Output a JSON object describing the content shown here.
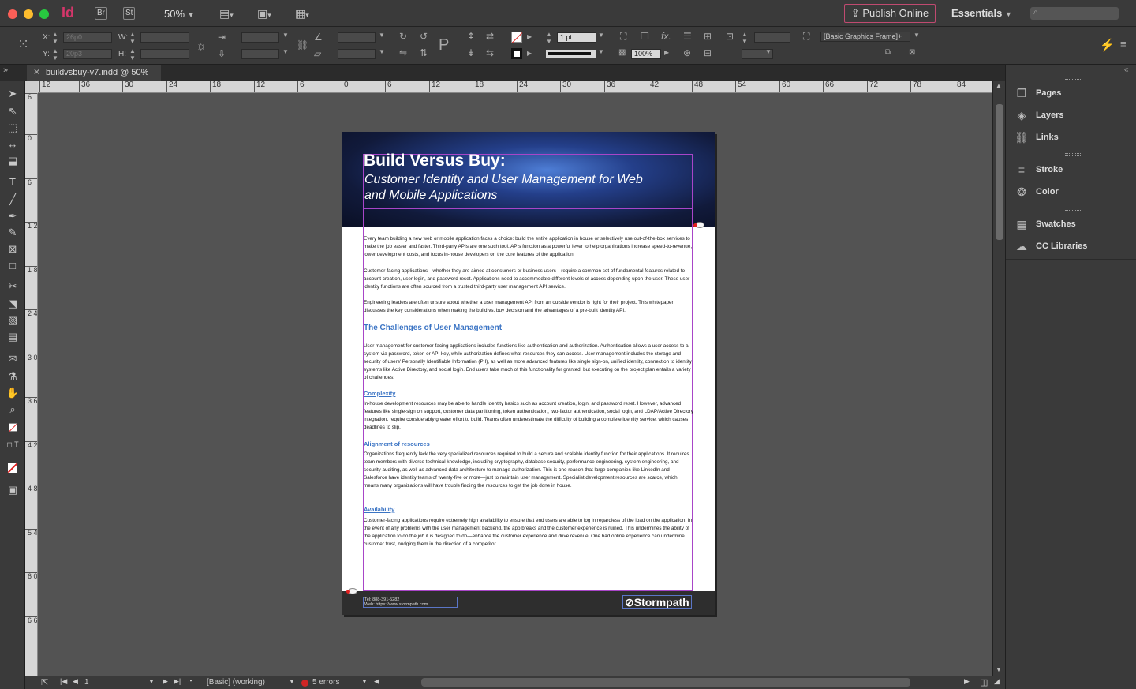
{
  "window": {
    "app_icon": "Id",
    "bridge_button": "Br",
    "stock_button": "St",
    "zoom": "50%",
    "publish_online": "Publish Online",
    "workspace": "Essentials"
  },
  "control": {
    "x_label": "X:",
    "x_value": "26p0",
    "y_label": "Y:",
    "y_value": "20p3",
    "w_label": "W:",
    "h_label": "H:",
    "stroke_weight": "1 pt",
    "opacity": "100%",
    "object_style": "[Basic Graphics Frame]+"
  },
  "tab": {
    "title": "buildvsbuy-v7.indd @ 50%"
  },
  "ruler": {
    "h_ticks": [
      "12",
      "36",
      "30",
      "24",
      "18",
      "12",
      "6",
      "0",
      "6",
      "12",
      "18",
      "24",
      "30",
      "36",
      "42",
      "48",
      "54",
      "60",
      "66",
      "72",
      "78",
      "84"
    ],
    "v_ticks": [
      "6",
      "0",
      "6",
      "1 2",
      "1 8",
      "2 4",
      "3 0",
      "3 6",
      "4 2",
      "4 8",
      "5 4",
      "6 0",
      "6 6"
    ]
  },
  "document": {
    "title": "Build Versus Buy:",
    "subtitle": "Customer Identity and User Management for Web and Mobile Applications",
    "intro_p1": "Every team building a new web or mobile application faces a choice: build the entire application in house or selectively use out-of-the-box services to make the job easier and faster. Third-party APIs are one such tool. APIs function as a powerful lever to help organizations increase speed-to-revenue, lower development costs, and focus in-house developers on the core features of the application.",
    "intro_p2": "Customer-facing applications—whether they are aimed at consumers or business users—require a common set of fundamental features related to account creation, user login, and password reset. Applications need to accommodate different levels of access depending upon the user. These user identity functions are often sourced from a trusted third-party user management API service.",
    "intro_p3": "Engineering leaders are often unsure about whether a user management API from an outside vendor is right for their project. This whitepaper discusses the key considerations when making the build vs. buy decision and the advantages of a pre-built identity API.",
    "section_heading": "The Challenges of User Management",
    "section_p1": "User management for customer-facing applications includes functions like authentication and authorization. Authentication allows a user access to a system via password, token or API key, while authorization defines what resources they can access. User management includes the storage and security of users' Personally Identifiable Information (PII), as well as more advanced features like single sign-on, unified identity, connection to identity systems like Active Directory, and social login. End users take much of this functionality for granted, but executing on the project plan entails a variety of challenges:",
    "complexity_heading": "Complexity",
    "complexity_p": "In-house development resources may be able to handle identity basics such as account creation, login, and password reset. However, advanced features like single-sign on support, customer data partitioning, token authentication, two-factor authentication, social login, and LDAP/Active Directory integration, require considerably greater effort to build. Teams often underestimate the difficulty of building a complete identity service, which causes deadlines to slip.",
    "alignment_heading": "Alignment of resources",
    "alignment_p": "Organizations frequently lack the very specialized resources required to build a secure and scalable identity function for their applications. It requires team members with diverse technical knowledge, including cryptography, database security, performance engineering, system engineering, and security auditing, as well as advanced data architecture to manage authorization. This is one reason that large companies like LinkedIn and Salesforce have identity teams of twenty-five or more—just to maintain user management. Specialist development resources are scarce, which means many organizations will have trouble finding the resources to get the job done in house.",
    "availability_heading": "Availability",
    "availability_p": "Customer-facing applications require extremely high availability to ensure that end users are able to log in regardless of the load on the application. In the event of any problems with the user management backend, the app breaks and the customer experience is ruined. This undermines the ability of the application to do the job it is designed to do—enhance the customer experience and drive revenue. One bad online experience can undermine customer trust, nudging them in the direction of a competitor.",
    "footer_tel": "Tel: 888-391-5282",
    "footer_web": "Web: https://www.stormpath.com",
    "footer_logo": "Stormpath"
  },
  "status": {
    "page_number": "1",
    "profile": "[Basic] (working)",
    "errors": "5 errors"
  },
  "panels": [
    {
      "label": "Pages",
      "icon": "pages-icon"
    },
    {
      "label": "Layers",
      "icon": "layers-icon"
    },
    {
      "label": "Links",
      "icon": "links-icon"
    },
    {
      "label": "Stroke",
      "icon": "stroke-icon"
    },
    {
      "label": "Color",
      "icon": "color-icon"
    },
    {
      "label": "Swatches",
      "icon": "swatches-icon"
    },
    {
      "label": "CC Libraries",
      "icon": "cc-libraries-icon"
    }
  ],
  "colors": {
    "frame_magenta": "#a845c8",
    "heading_blue": "#3b74c4",
    "publish_border": "#c04a70"
  }
}
